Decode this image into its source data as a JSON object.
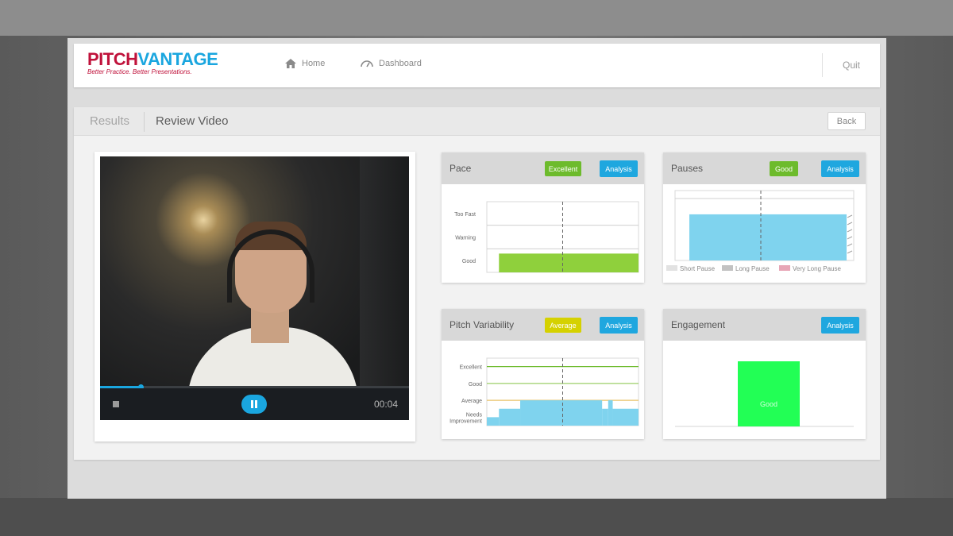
{
  "app": {
    "logo_pitch": "PITCH",
    "logo_vantage": "VANTAGE",
    "logo_tagline": "Better Practice. Better Presentations."
  },
  "nav": {
    "home_label": "Home",
    "dashboard_label": "Dashboard",
    "quit_label": "Quit"
  },
  "subheader": {
    "results_label": "Results",
    "review_label": "Review Video",
    "back_label": "Back"
  },
  "video": {
    "time": "00:04",
    "progress": 0.13
  },
  "panels": {
    "pace": {
      "title": "Pace",
      "badge": "Excellent",
      "analysis_label": "Analysis",
      "badge_color": "#6dbb2c"
    },
    "pauses": {
      "title": "Pauses",
      "badge": "Good",
      "analysis_label": "Analysis",
      "badge_color": "#6dbb2c"
    },
    "pitch": {
      "title": "Pitch Variability",
      "badge": "Average",
      "analysis_label": "Analysis",
      "badge_color": "#d5d100"
    },
    "engagement": {
      "title": "Engagement",
      "analysis_label": "Analysis"
    }
  },
  "chart_data": [
    {
      "id": "pace",
      "type": "bar",
      "categories": [
        "Good",
        "Warning",
        "Too Fast"
      ],
      "bar": {
        "level": "Good",
        "from": 0.08,
        "to": 1.0,
        "color": "#8fd03c"
      },
      "marker": 0.5
    },
    {
      "id": "pauses",
      "type": "bar",
      "legend": [
        "Short Pause",
        "Long Pause",
        "Very Long Pause"
      ],
      "legend_colors": [
        "#cfcfcf",
        "#9a9a9a",
        "#d76a86"
      ],
      "bar": {
        "from": 0.08,
        "to": 0.96,
        "height": 0.66,
        "color": "#7fd3ee"
      },
      "marker": 0.48
    },
    {
      "id": "pitch",
      "type": "area",
      "levels": [
        "Needs Improvement",
        "Average",
        "Good",
        "Excellent"
      ],
      "level_colors": [
        "#ffffff",
        "#e9c36a",
        "#9bcf67",
        "#6dbb2c"
      ],
      "segments": [
        {
          "from": 0.0,
          "to": 0.08,
          "level": 0
        },
        {
          "from": 0.08,
          "to": 0.22,
          "level": 0.5
        },
        {
          "from": 0.22,
          "to": 0.76,
          "level": 1.0
        },
        {
          "from": 0.76,
          "to": 0.8,
          "level": 0.5
        },
        {
          "from": 0.8,
          "to": 0.83,
          "level": 1.0
        },
        {
          "from": 0.83,
          "to": 1.0,
          "level": 0.5
        }
      ],
      "color": "#7fd3ee",
      "marker": 0.5
    },
    {
      "id": "engagement",
      "type": "bar",
      "categories": [
        "Good"
      ],
      "values": [
        1
      ],
      "bar_label": "Good",
      "color": "#22ff55"
    }
  ]
}
